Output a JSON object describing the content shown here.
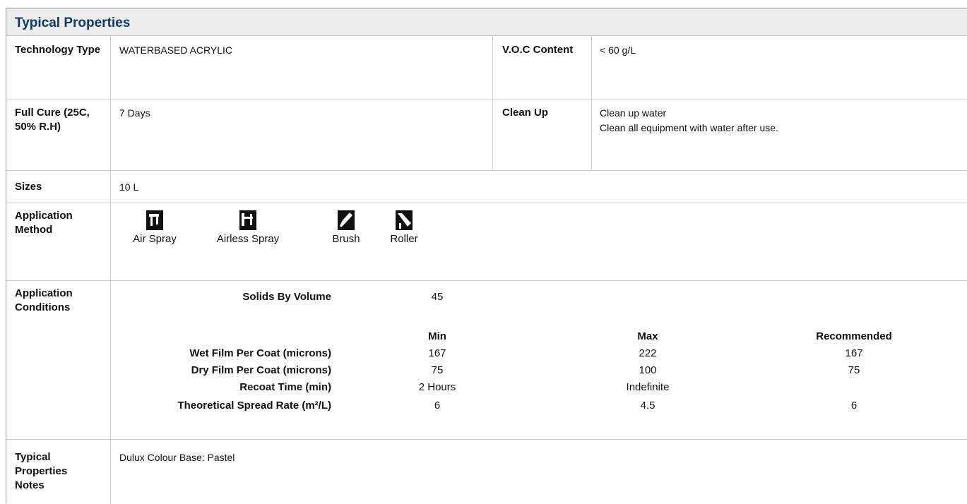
{
  "title": "Typical Properties",
  "technology_type": {
    "label": "Technology Type",
    "value": "WATERBASED ACRYLIC"
  },
  "voc": {
    "label": "V.O.C Content",
    "value": "< 60 g/L"
  },
  "full_cure": {
    "label": "Full Cure (25C, 50% R.H)",
    "value": "7 Days"
  },
  "clean_up": {
    "label": "Clean Up",
    "line1": "Clean up water",
    "line2": "Clean all equipment with water after use."
  },
  "sizes": {
    "label": "Sizes",
    "value": "10 L"
  },
  "application_method": {
    "label": "Application Method",
    "methods": [
      {
        "name": "Air Spray",
        "icon": "air-spray-icon"
      },
      {
        "name": "Airless Spray",
        "icon": "airless-spray-icon"
      },
      {
        "name": "Brush",
        "icon": "brush-icon"
      },
      {
        "name": "Roller",
        "icon": "roller-icon"
      }
    ]
  },
  "application_conditions": {
    "label": "Application Conditions",
    "solids_label": "Solids By Volume",
    "solids_value": "45",
    "columns": [
      "Min",
      "Max",
      "Recommended"
    ],
    "rows": [
      {
        "label": "Wet Film Per Coat (microns)",
        "min": "167",
        "max": "222",
        "recommended": "167"
      },
      {
        "label": "Dry Film Per Coat (microns)",
        "min": "75",
        "max": "100",
        "recommended": "75"
      },
      {
        "label": "Recoat Time (min)",
        "min": "2 Hours",
        "max": "Indefinite",
        "recommended": ""
      },
      {
        "label": "Theoretical Spread Rate (m²/L)",
        "min": "6",
        "max": "4.5",
        "recommended": "6"
      }
    ]
  },
  "notes": {
    "label": "Typical Properties Notes",
    "value": "Dulux Colour Base: Pastel"
  }
}
